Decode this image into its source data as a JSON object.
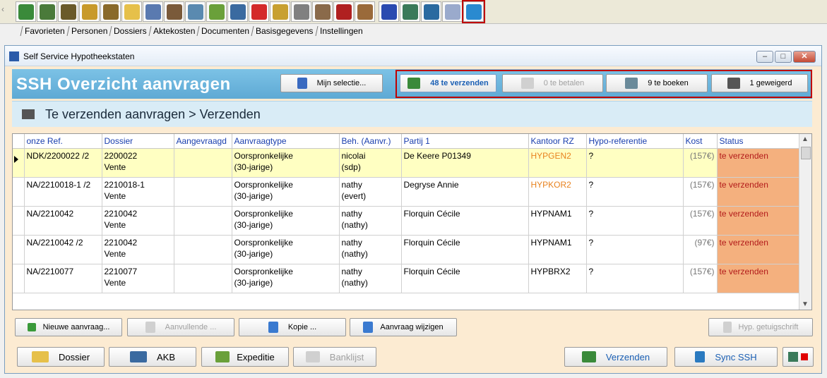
{
  "toolbar": {
    "icons": [
      {
        "name": "tree-icon",
        "color": "#3a8a3a"
      },
      {
        "name": "persons-icon",
        "color": "#4a7a3a"
      },
      {
        "name": "person-doc-icon",
        "color": "#6a5a2a"
      },
      {
        "name": "person-icon",
        "color": "#c89a2a"
      },
      {
        "name": "person-file-icon",
        "color": "#8a6a2a"
      },
      {
        "name": "folder-icon",
        "color": "#e6c04a"
      },
      {
        "name": "home-icon",
        "color": "#5a7ab0"
      },
      {
        "name": "building-doc-icon",
        "color": "#7a5a3a"
      },
      {
        "name": "building-icon",
        "color": "#5a8ab0"
      },
      {
        "name": "checklist-icon",
        "color": "#6aa03a"
      },
      {
        "name": "ledger-icon",
        "color": "#3a6aa0"
      },
      {
        "name": "zap-icon",
        "color": "#d42a2a"
      },
      {
        "name": "coins-icon",
        "color": "#c8a030"
      },
      {
        "name": "notebook-icon",
        "color": "#808080"
      },
      {
        "name": "building-person-icon",
        "color": "#8a6a4a"
      },
      {
        "name": "er-icon",
        "color": "#b02020"
      },
      {
        "name": "stamp-icon",
        "color": "#9a6a3a"
      },
      {
        "name": "plus-plus-icon",
        "color": "#2a4ab0"
      },
      {
        "name": "table-icon",
        "color": "#3a7a5a"
      },
      {
        "name": "book-icon",
        "color": "#2a6aa0"
      },
      {
        "name": "hand-icon",
        "color": "#9aaacc"
      },
      {
        "name": "ssh-icon",
        "color": "#2a8ad0"
      }
    ]
  },
  "menu": [
    "Favorieten",
    "Personen",
    "Dossiers",
    "Aktekosten",
    "Documenten",
    "Basisgegevens",
    "Instellingen"
  ],
  "window": {
    "title": "Self Service Hypotheekstaten",
    "header_title": "SSH  Overzicht aanvragen",
    "selection_btn": "Mijn selectie...",
    "status_buttons": [
      {
        "label": "48 te verzenden",
        "state": "active"
      },
      {
        "label": "0 te betalen",
        "state": "disabled"
      },
      {
        "label": "9 te boeken",
        "state": "normal"
      },
      {
        "label": "1 geweigerd",
        "state": "normal"
      }
    ],
    "subheader": "Te verzenden aanvragen > Verzenden"
  },
  "grid": {
    "columns": [
      "onze Ref.",
      "Dossier",
      "Aangevraagd",
      "Aanvraagtype",
      "Beh. (Aanvr.)",
      "Partij 1",
      "Kantoor RZ",
      "Hypo-referentie",
      "Kost",
      "Status"
    ],
    "rows": [
      {
        "ref": "NDK/2200022 /2",
        "dossier": [
          "2200022",
          "Vente"
        ],
        "aangevraagd": "",
        "type": [
          "Oorspronkelijke",
          "(30-jarige)"
        ],
        "beh": [
          "nicolai",
          "(sdp)"
        ],
        "partij": "De Keere P01349",
        "kantoor": "HYPGEN2",
        "kantoor_orange": true,
        "hypo": "?",
        "kost": "(157€)",
        "status": "te verzenden",
        "selected": true
      },
      {
        "ref": "NA/2210018-1 /2",
        "dossier": [
          "2210018-1",
          "Vente"
        ],
        "aangevraagd": "",
        "type": [
          "Oorspronkelijke",
          "(30-jarige)"
        ],
        "beh": [
          "nathy",
          "(evert)"
        ],
        "partij": "Degryse Annie",
        "kantoor": "HYPKOR2",
        "kantoor_orange": true,
        "hypo": "?",
        "kost": "(157€)",
        "status": "te verzenden",
        "selected": false
      },
      {
        "ref": "NA/2210042",
        "dossier": [
          "2210042",
          "Vente"
        ],
        "aangevraagd": "",
        "type": [
          "Oorspronkelijke",
          "(30-jarige)"
        ],
        "beh": [
          "nathy",
          "(nathy)"
        ],
        "partij": "Florquin Cécile",
        "kantoor": "HYPNAM1",
        "kantoor_orange": false,
        "hypo": "?",
        "kost": "(157€)",
        "status": "te verzenden",
        "selected": false
      },
      {
        "ref": "NA/2210042 /2",
        "dossier": [
          "2210042",
          "Vente"
        ],
        "aangevraagd": "",
        "type": [
          "Oorspronkelijke",
          "(30-jarige)"
        ],
        "beh": [
          "nathy",
          "(nathy)"
        ],
        "partij": "Florquin Cécile",
        "kantoor": "HYPNAM1",
        "kantoor_orange": false,
        "hypo": "?",
        "kost": "(97€)",
        "status": "te verzenden",
        "selected": false
      },
      {
        "ref": "NA/2210077",
        "dossier": [
          "2210077",
          "Vente"
        ],
        "aangevraagd": "",
        "type": [
          "Oorspronkelijke",
          "(30-jarige)"
        ],
        "beh": [
          "nathy",
          "(nathy)"
        ],
        "partij": "Florquin Cécile",
        "kantoor": "HYPBRX2",
        "kantoor_orange": false,
        "hypo": "?",
        "kost": "(157€)",
        "status": "te verzenden",
        "selected": false
      }
    ]
  },
  "actions": {
    "new": "Nieuwe aanvraag...",
    "supplement": "Aanvullende ...",
    "copy": "Kopie ...",
    "edit": "Aanvraag wijzigen",
    "hyp_cert": "Hyp. getuigschrift"
  },
  "bottom": {
    "dossier": "Dossier",
    "akb": "AKB",
    "expeditie": "Expeditie",
    "banklijst": "Banklijst",
    "verzenden": "Verzenden",
    "sync": "Sync SSH"
  }
}
